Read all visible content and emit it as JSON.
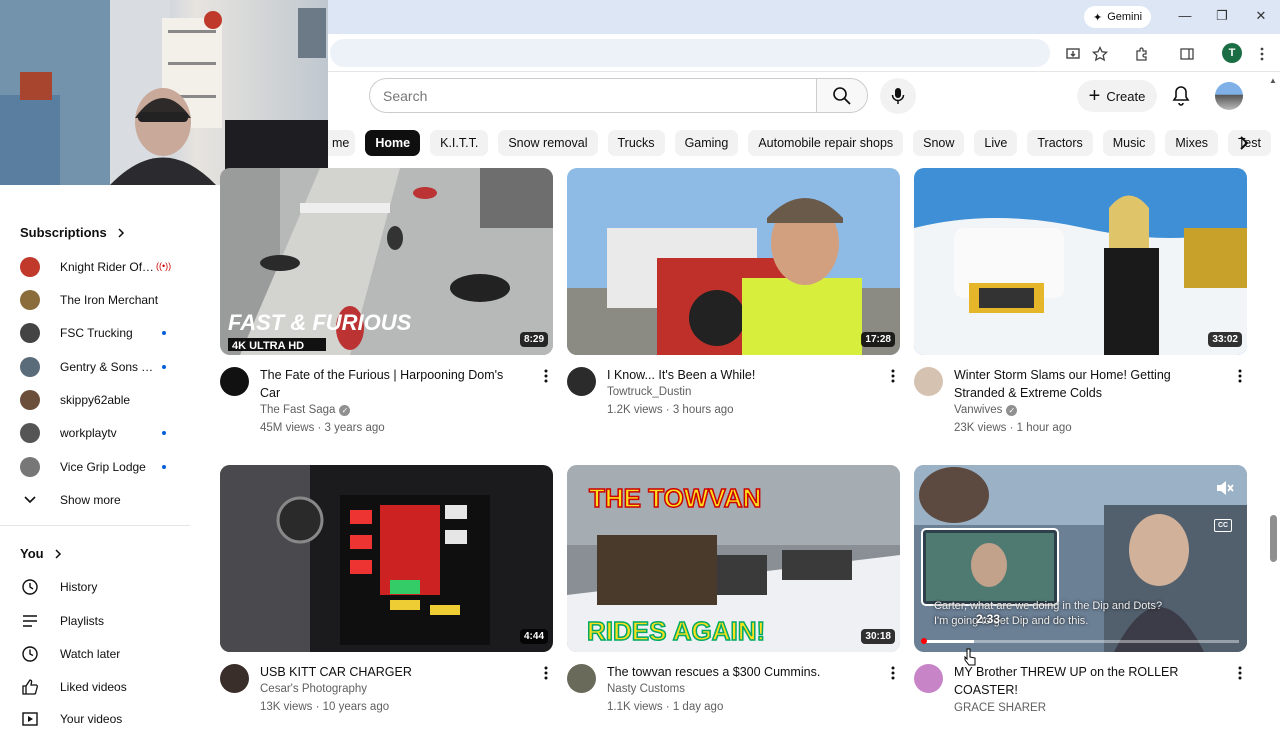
{
  "browser": {
    "gemini_label": "Gemini",
    "profile_initial": "T"
  },
  "header": {
    "search_placeholder": "Search",
    "create_label": "Create"
  },
  "chips": [
    {
      "label": "me"
    },
    {
      "label": "Home",
      "active": true
    },
    {
      "label": "K.I.T.T."
    },
    {
      "label": "Snow removal"
    },
    {
      "label": "Trucks"
    },
    {
      "label": "Gaming"
    },
    {
      "label": "Automobile repair shops"
    },
    {
      "label": "Snow"
    },
    {
      "label": "Live"
    },
    {
      "label": "Tractors"
    },
    {
      "label": "Music"
    },
    {
      "label": "Mixes"
    },
    {
      "label": "Test"
    }
  ],
  "sidebar": {
    "subscriptions_title": "Subscriptions",
    "subscriptions": [
      {
        "name": "Knight Rider Offi...",
        "status": "live",
        "color": "#c0392b"
      },
      {
        "name": "The Iron Merchant",
        "status": "",
        "color": "#8a6d3b"
      },
      {
        "name": "FSC Trucking",
        "status": "dot",
        "color": "#444444"
      },
      {
        "name": "Gentry & Sons Tr...",
        "status": "dot",
        "color": "#5a6b7a"
      },
      {
        "name": "skippy62able",
        "status": "",
        "color": "#6b4f3a"
      },
      {
        "name": "workplaytv",
        "status": "dot",
        "color": "#555555"
      },
      {
        "name": "Vice Grip Lodge",
        "status": "dot",
        "color": "#777777"
      }
    ],
    "show_more": "Show more",
    "you_title": "You",
    "you_items": [
      {
        "label": "History",
        "icon": "history-icon"
      },
      {
        "label": "Playlists",
        "icon": "playlists-icon"
      },
      {
        "label": "Watch later",
        "icon": "watch-later-icon"
      },
      {
        "label": "Liked videos",
        "icon": "liked-videos-icon"
      },
      {
        "label": "Your videos",
        "icon": "your-videos-icon"
      }
    ]
  },
  "videos": [
    {
      "title_l1": "The Fate of the Furious | Harpooning Dom's",
      "title_l2": "Car",
      "channel": "The Fast Saga",
      "verified": true,
      "meta": "45M views · 3 years ago",
      "duration": "8:29",
      "thumb_text": "FAST & FURIOUS",
      "thumb_sub": "4K ULTRA HD"
    },
    {
      "title_l1": "I Know... It's Been a While!",
      "title_l2": "",
      "channel": "Towtruck_Dustin",
      "verified": false,
      "meta": "1.2K views · 3 hours ago",
      "duration": "17:28"
    },
    {
      "title_l1": "Winter Storm Slams our Home! Getting",
      "title_l2": "Stranded & Extreme Colds",
      "channel": "Vanwives",
      "verified": true,
      "meta": "23K views · 1 hour ago",
      "duration": "33:02"
    },
    {
      "title_l1": "USB KITT CAR CHARGER",
      "title_l2": "",
      "channel": "Cesar's Photography",
      "verified": false,
      "meta": "13K views · 10 years ago",
      "duration": "4:44"
    },
    {
      "title_l1": "The towvan rescues a $300 Cummins.",
      "title_l2": "",
      "channel": "Nasty Customs",
      "verified": false,
      "meta": "1.1K views · 1 day ago",
      "duration": "30:18",
      "thumb_text": "THE TOWVAN",
      "thumb_sub": "RIDES AGAIN!"
    },
    {
      "title_l1": "MY Brother THREW UP on the ROLLER",
      "title_l2": "COASTER!",
      "channel": "GRACE SHARER",
      "verified": false,
      "meta": "",
      "duration": "",
      "preview_caption": "Carter, what are we doing in the Dip and Dots? I'm going to get Dip and do this.",
      "preview_time": "2:33",
      "cc_label": "CC"
    }
  ]
}
